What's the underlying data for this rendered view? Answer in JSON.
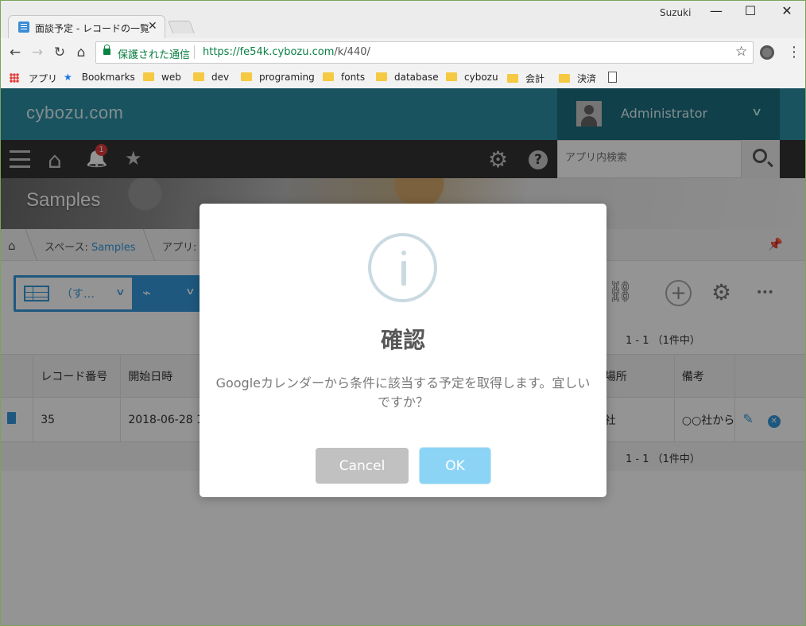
{
  "browser": {
    "tab_title": "面談予定 - レコードの一覧",
    "tab_close": "✕",
    "user": "Suzuki",
    "window_controls": {
      "minimize": "—",
      "maximize": "☐",
      "close": "✕"
    },
    "nav": {
      "back": "←",
      "forward": "→",
      "reload": "↻",
      "home": "⌂"
    },
    "security_label": "保護された通信",
    "url_host": "https://fe54k.cybozu.com",
    "url_path": "/k/440/",
    "star": "☆",
    "menu": "⋮",
    "bookmarks": [
      "アプリ",
      "Bookmarks",
      "web",
      "dev",
      "programing",
      "fonts",
      "database",
      "cybozu",
      "会計",
      "決済"
    ]
  },
  "app": {
    "logo": "cybozu.com",
    "user_name": "Administrator",
    "user_chevron": "∨",
    "notification_count": "1",
    "search_placeholder": "アプリ内検索",
    "icons": {
      "home": "⌂",
      "bell": "🔔",
      "star": "★",
      "gear": "⚙",
      "help": "?"
    },
    "space_title": "Samples",
    "breadcrumb": {
      "home": "⌂",
      "space_prefix": "スペース: ",
      "space_link": "Samples",
      "app_prefix": "アプリ: "
    },
    "pin": "📌",
    "view": {
      "label": "（す…",
      "chevron": "∨",
      "graph_chevron": "∨",
      "graph_icon": "⌁"
    },
    "toolbar": {
      "add": "+",
      "settings": "⚙",
      "more": "•••",
      "link": "⛓"
    },
    "pager": "1 - 1 （1件中）",
    "table": {
      "headers": [
        "",
        "レコード番号",
        "開始日時",
        "",
        "",
        "",
        "場所",
        "備考",
        ""
      ],
      "rows": [
        {
          "record_no": "35",
          "start": "2018-06-28 1",
          "place": "社",
          "note": "○○社から"
        }
      ]
    }
  },
  "dialog": {
    "title": "確認",
    "message": "Googleカレンダーから条件に該当する予定を取得します。宜しいですか？",
    "cancel": "Cancel",
    "ok": "OK"
  },
  "colors": {
    "header": "#2b8fa4",
    "nav": "#333333",
    "accent": "#3498db",
    "ok_button": "#8cd4f5",
    "cancel_button": "#c1c1c1"
  }
}
